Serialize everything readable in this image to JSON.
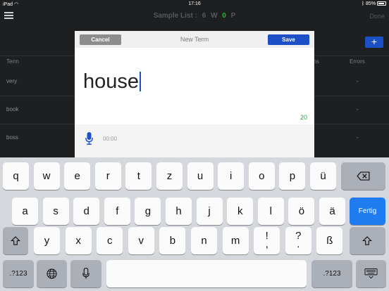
{
  "status_bar": {
    "device": "iPad",
    "time": "17:16",
    "battery": "85%",
    "battery_level": 0.85
  },
  "nav": {
    "title": "Sample List :",
    "count": "6",
    "w_label": "W",
    "w_count": "0",
    "p_label": "P",
    "done": "Done"
  },
  "list": {
    "add_label": "+",
    "headers": {
      "term": "Term",
      "sessions": "ons",
      "errors": "Errors"
    },
    "rows": [
      {
        "term": "very",
        "errors": "-"
      },
      {
        "term": "book",
        "errors": "-"
      },
      {
        "term": "boss",
        "errors": "-"
      }
    ]
  },
  "modal": {
    "cancel": "Cancel",
    "title": "New Term",
    "save": "Save",
    "term_value": "house",
    "char_count": "20",
    "audio_time": "00:00"
  },
  "keyboard": {
    "row1": [
      "q",
      "w",
      "e",
      "r",
      "t",
      "z",
      "u",
      "i",
      "o",
      "p",
      "ü"
    ],
    "row2": [
      "a",
      "s",
      "d",
      "f",
      "g",
      "h",
      "j",
      "k",
      "l",
      "ö",
      "ä"
    ],
    "row3": [
      "y",
      "x",
      "c",
      "v",
      "b",
      "n",
      "m",
      "!",
      "?",
      "ß"
    ],
    "row3_sub": [
      ",",
      "."
    ],
    "return_label": "Fertig",
    "numbers_label": ".?123",
    "colors": {
      "accent": "#1d4fc7",
      "return": "#1f7cf0",
      "count": "#28a43a"
    }
  }
}
